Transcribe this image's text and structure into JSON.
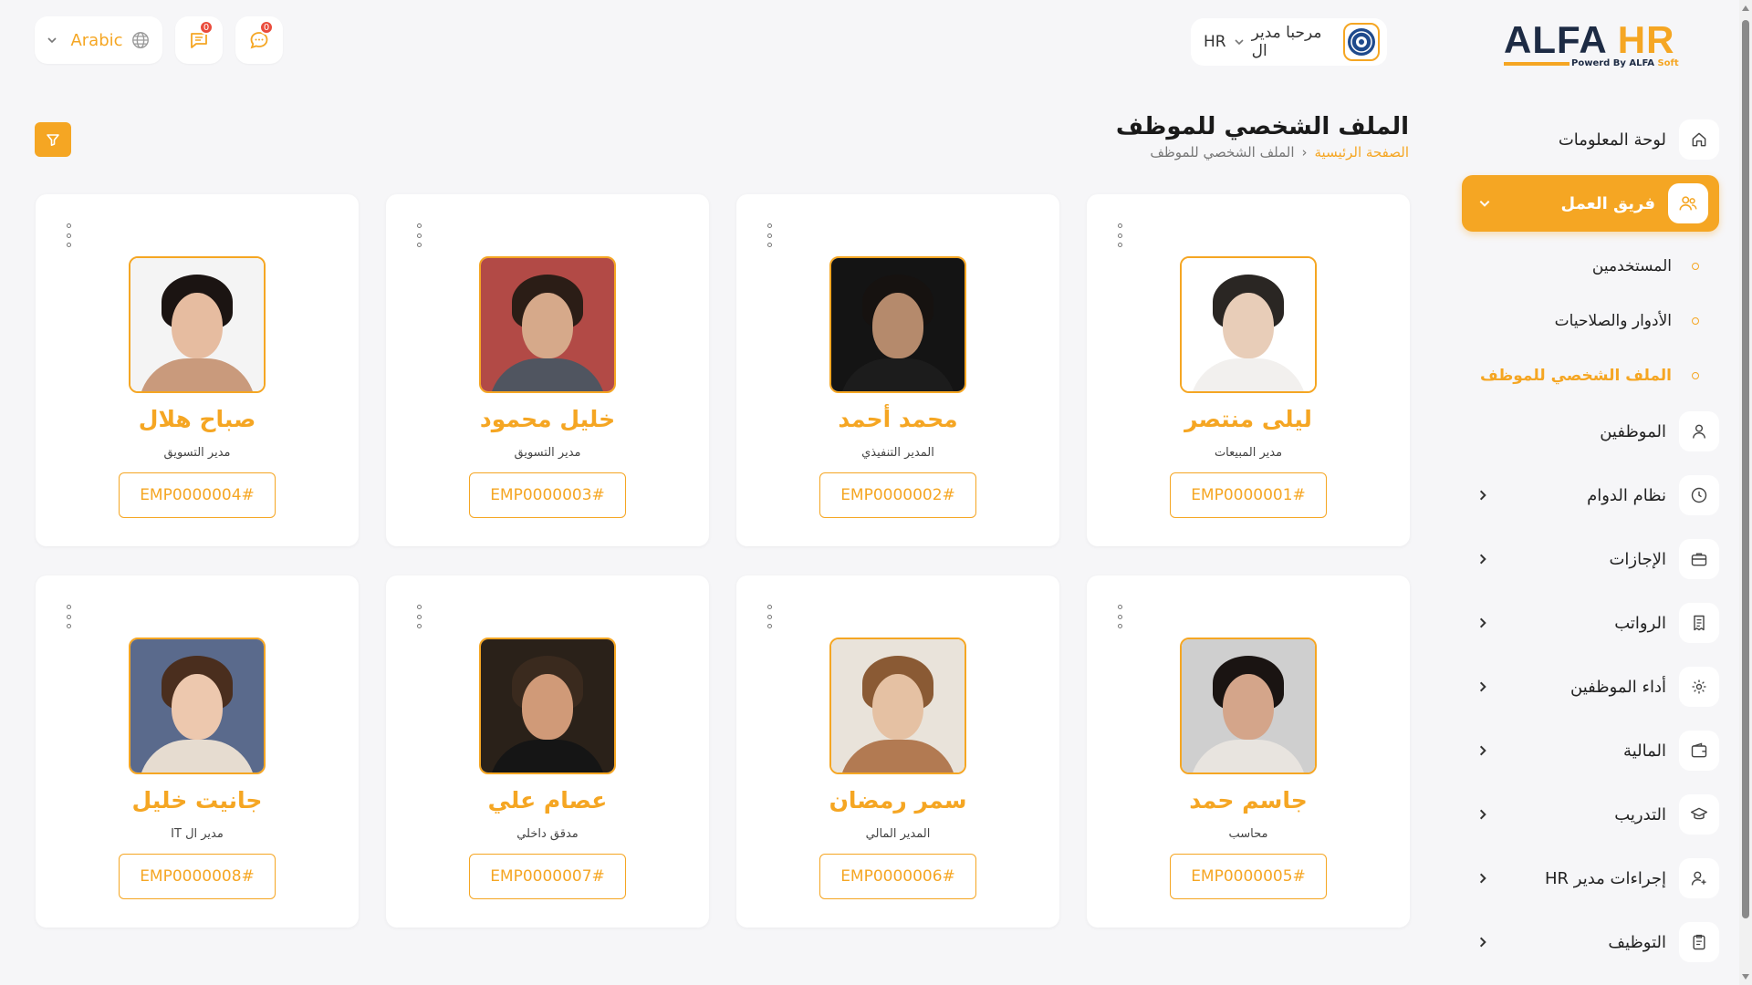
{
  "topbar": {
    "language": "Arabic",
    "notifications_count": "0",
    "messages_count": "0",
    "user_greeting": "مرحبا مدير ال",
    "user_role": "HR"
  },
  "logo": {
    "alfa": "ALFA",
    "hr": "HR",
    "tagline": "Powerd By ALFA",
    "tagline_soft": "Soft"
  },
  "page": {
    "title": "الملف الشخصي للموظف",
    "breadcrumb_home": "الصفحة الرئيسية",
    "breadcrumb_sep": "‹",
    "breadcrumb_current": "الملف الشخصي للموظف"
  },
  "employees": [
    {
      "name": "ليلى منتصر",
      "title": "مدير المبيعات",
      "code": "EMP0000001#",
      "photo": {
        "bg": "#ffffff",
        "hair": "#2a2623",
        "face": "#e8cdb8",
        "body": "#f2f0ee"
      }
    },
    {
      "name": "محمد أحمد",
      "title": "المدير التنفيذي",
      "code": "EMP0000002#",
      "photo": {
        "bg": "#141414",
        "hair": "#161210",
        "face": "#b58a6c",
        "body": "#1c1c1c"
      }
    },
    {
      "name": "خليل محمود",
      "title": "مدير التسويق",
      "code": "EMP0000003#",
      "photo": {
        "bg": "#b24a46",
        "hair": "#2b1d16",
        "face": "#d6a98a",
        "body": "#505560"
      }
    },
    {
      "name": "صباح هلال",
      "title": "مدير التسويق",
      "code": "EMP0000004#",
      "photo": {
        "bg": "#f4f4f4",
        "hair": "#1b1412",
        "face": "#e6bca0",
        "body": "#c99a7c"
      }
    },
    {
      "name": "جاسم حمد",
      "title": "محاسب",
      "code": "EMP0000005#",
      "photo": {
        "bg": "#cfcfcf",
        "hair": "#1a1412",
        "face": "#d4a58a",
        "body": "#e8e4df"
      }
    },
    {
      "name": "سمر رمضان",
      "title": "المدير المالي",
      "code": "EMP0000006#",
      "photo": {
        "bg": "#e9e3da",
        "hair": "#8a5a34",
        "face": "#e5c1a3",
        "body": "#b27a52"
      }
    },
    {
      "name": "عصام علي",
      "title": "مدقق داخلي",
      "code": "EMP0000007#",
      "photo": {
        "bg": "#2a2119",
        "hair": "#3a2a1e",
        "face": "#d09a78",
        "body": "#151515"
      }
    },
    {
      "name": "جانيت خليل",
      "title": "مدير ال IT",
      "code": "EMP0000008#",
      "photo": {
        "bg": "#5a6a8c",
        "hair": "#4a2e1e",
        "face": "#edc8ae",
        "body": "#e6dcd0"
      }
    }
  ],
  "sidebar": {
    "items": [
      {
        "label": "لوحة المعلومات",
        "icon": "home-icon"
      },
      {
        "label": "فريق العمل",
        "icon": "team-icon"
      },
      {
        "label": "الموظفين",
        "icon": "user-icon"
      },
      {
        "label": "نظام الدوام",
        "icon": "clock-icon"
      },
      {
        "label": "الإجازات",
        "icon": "briefcase-icon"
      },
      {
        "label": "الرواتب",
        "icon": "receipt-icon"
      },
      {
        "label": "أداء الموظفين",
        "icon": "performance-icon"
      },
      {
        "label": "المالية",
        "icon": "wallet-icon"
      },
      {
        "label": "التدريب",
        "icon": "graduation-cap-icon"
      },
      {
        "label": "إجراءات مدير HR",
        "icon": "user-plus-icon"
      },
      {
        "label": "التوظيف",
        "icon": "clipboard-icon"
      }
    ],
    "sub_items": [
      {
        "label": "المستخدمين"
      },
      {
        "label": "الأدوار والصلاحيات"
      },
      {
        "label": "الملف الشخصي للموظف"
      }
    ]
  },
  "colors": {
    "accent": "#f5a623",
    "navy": "#1d2b44",
    "badge": "#ea4c3c",
    "background": "#f6f6f8"
  }
}
